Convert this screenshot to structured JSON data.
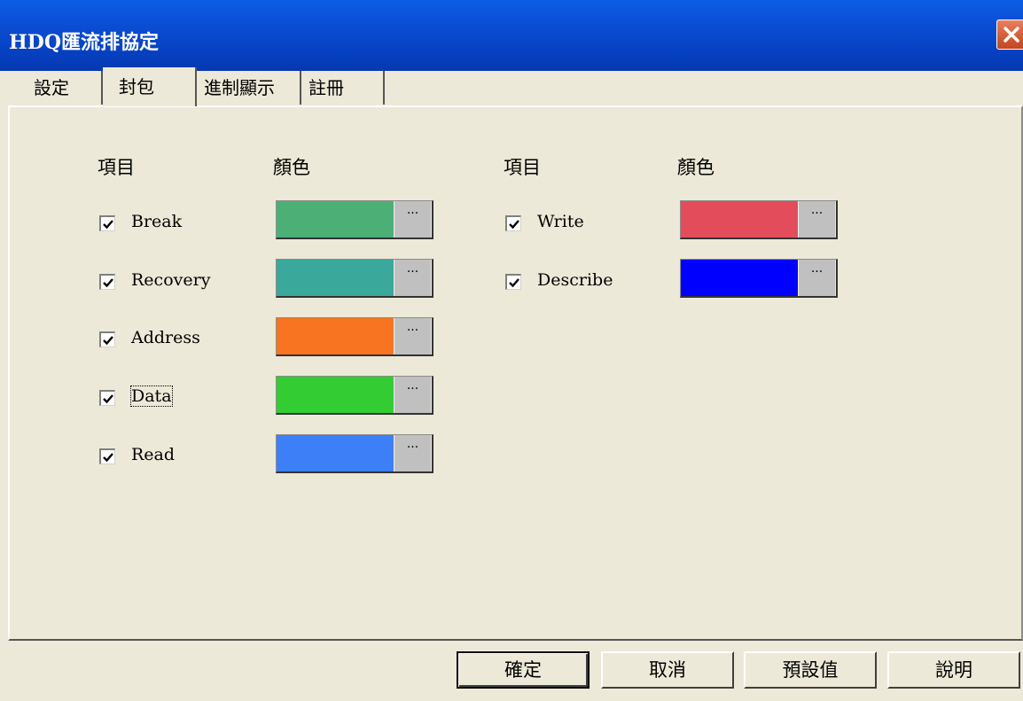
{
  "window": {
    "title": "HDQ匯流排協定"
  },
  "tabs": [
    {
      "label": "設定"
    },
    {
      "label": "封包"
    },
    {
      "label": "進制顯示"
    },
    {
      "label": "註冊"
    }
  ],
  "selected_tab": "封包",
  "columns": {
    "left": {
      "item_header": "項目",
      "color_header": "顏色"
    },
    "right": {
      "item_header": "項目",
      "color_header": "顏色"
    }
  },
  "items_left": [
    {
      "label": "Break",
      "checked": true,
      "color": "#4caf76"
    },
    {
      "label": "Recovery",
      "checked": true,
      "color": "#3aa89a"
    },
    {
      "label": "Address",
      "checked": true,
      "color": "#f87420"
    },
    {
      "label": "Data",
      "checked": true,
      "color": "#33cc33"
    },
    {
      "label": "Read",
      "checked": true,
      "color": "#3d7ff7"
    }
  ],
  "items_right": [
    {
      "label": "Write",
      "checked": true,
      "color": "#e34d5b"
    },
    {
      "label": "Describe",
      "checked": true,
      "color": "#0000ff"
    }
  ],
  "picker_button_label": "···",
  "buttons": {
    "ok": "確定",
    "cancel": "取消",
    "defaults": "預設值",
    "help": "說明"
  }
}
